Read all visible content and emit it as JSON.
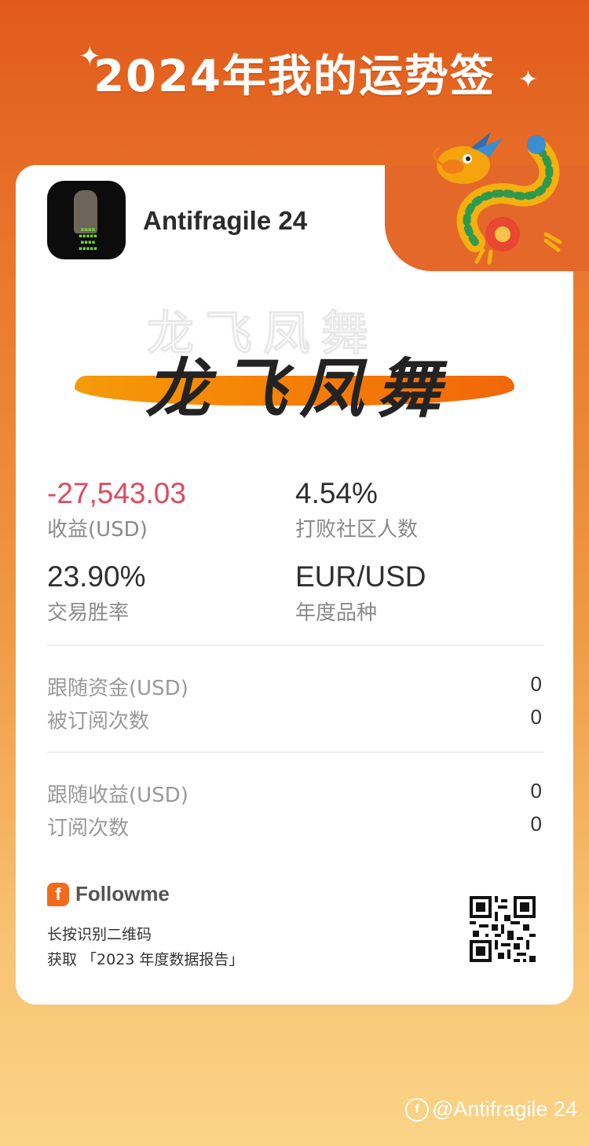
{
  "header": {
    "title": "2024年我的运势签"
  },
  "profile": {
    "username": "Antifragile 24"
  },
  "fortune": {
    "slogan": "龙飞凤舞"
  },
  "stats": {
    "profit": {
      "value": "-27,543.03",
      "label": "收益(USD)"
    },
    "beat_community": {
      "value": "4.54%",
      "label": "打败社区人数"
    },
    "win_rate": {
      "value": "23.90%",
      "label": "交易胜率"
    },
    "annual_symbol": {
      "value": "EUR/USD",
      "label": "年度品种"
    }
  },
  "follow_section": [
    {
      "label": "跟随资金(USD)",
      "value": "0"
    },
    {
      "label": "被订阅次数",
      "value": "0"
    }
  ],
  "follow_section_2": [
    {
      "label": "跟随收益(USD)",
      "value": "0"
    },
    {
      "label": "订阅次数",
      "value": "0"
    }
  ],
  "footer": {
    "brand_icon_letter": "f",
    "brand": "Followme",
    "hint_line1": "长按识别二维码",
    "hint_line2": "获取 「2023 年度数据报告」"
  },
  "watermark": {
    "icon_letter": "f",
    "text": "@Antifragile 24"
  },
  "colors": {
    "accent": "#f26a1b",
    "negative": "#de4a5f",
    "background_top": "#e15a1c",
    "background_bottom": "#fbd487"
  }
}
